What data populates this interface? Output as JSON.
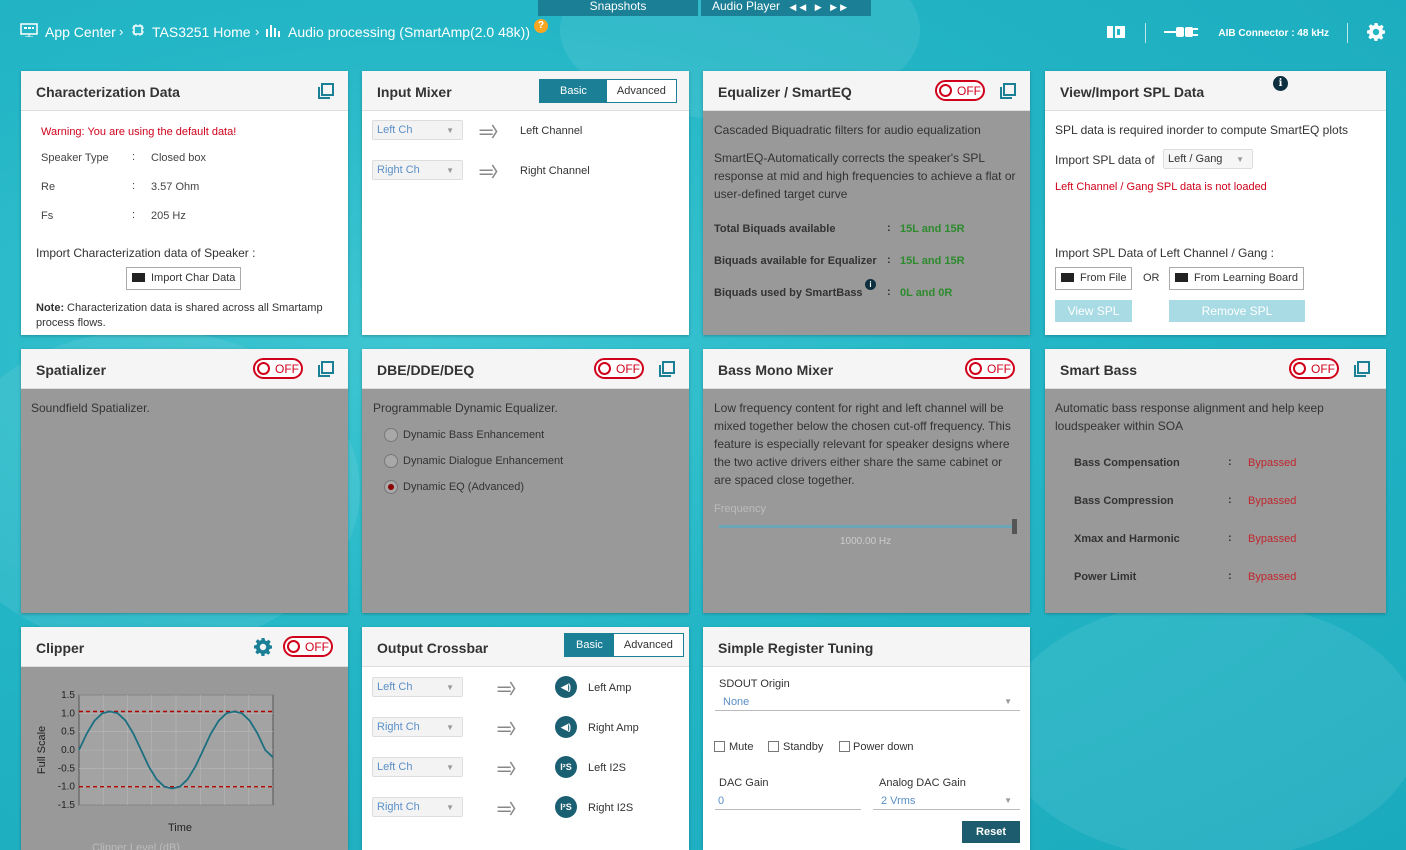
{
  "topbar": {
    "snapshots": "Snapshots",
    "audio_player": "Audio Player",
    "player_controls": "◀◀ ▶ ▶▶"
  },
  "breadcrumb": {
    "app_center": "App Center",
    "home": "TAS3251 Home",
    "audio_processing": "Audio processing (SmartAmp(2.0 48k))",
    "help": "?"
  },
  "status": {
    "connector": "AIB Connector : 48 kHz"
  },
  "colors": {
    "accent": "#1b7f96",
    "off_red": "#d0021b",
    "bypassed_red": "#c0262d",
    "value_green": "#2d8a2d"
  },
  "char": {
    "title": "Characterization Data",
    "warning": "Warning: You are using the default data!",
    "rows": [
      {
        "label": "Speaker Type",
        "sep": ":",
        "value": "Closed box"
      },
      {
        "label": "Re",
        "sep": ":",
        "value": "3.57 Ohm"
      },
      {
        "label": "Fs",
        "sep": ":",
        "value": "205 Hz"
      }
    ],
    "import_label": "Import Characterization data of Speaker :",
    "import_btn": "Import Char Data",
    "note_bold": "Note:",
    "note_line1": "Characterization data is shared across all Smartamp",
    "note_line2": "process flows."
  },
  "input_mixer": {
    "title": "Input Mixer",
    "basic": "Basic",
    "advanced": "Advanced",
    "rows": [
      {
        "select": "Left Ch",
        "target": "Left Channel"
      },
      {
        "select": "Right Ch",
        "target": "Right Channel"
      }
    ]
  },
  "equalizer": {
    "title": "Equalizer / SmartEQ",
    "toggle": "OFF",
    "desc1": "Cascaded Biquadratic filters for audio equalization",
    "desc2": [
      "SmartEQ-Automatically corrects the speaker's SPL",
      "response at mid and high frequencies to achieve a flat or",
      "user-defined target curve"
    ],
    "rows": [
      {
        "label": "Total Biquads available",
        "sep": ":",
        "value": "15L and 15R"
      },
      {
        "label": "Biquads available for Equalizer",
        "sep": ":",
        "value": "15L and 15R"
      },
      {
        "label": "Biquads used by SmartBass",
        "sep": ":",
        "value": "0L and 0R"
      }
    ],
    "info": "i"
  },
  "spl": {
    "title": "View/Import SPL Data",
    "info": "i",
    "desc": "SPL data is required inorder to compute SmartEQ plots",
    "import_of": "Import SPL data of",
    "select": "Left / Gang",
    "error": "Left Channel / Gang SPL data is not loaded",
    "import_label": "Import SPL Data of Left Channel / Gang :",
    "from_file": "From File",
    "or": "OR",
    "from_board": "From Learning Board",
    "view": "View SPL",
    "remove": "Remove SPL"
  },
  "spatializer": {
    "title": "Spatializer",
    "toggle": "OFF",
    "desc": "Soundfield Spatializer."
  },
  "dbe": {
    "title": "DBE/DDE/DEQ",
    "toggle": "OFF",
    "desc": "Programmable Dynamic Equalizer.",
    "options": [
      "Dynamic Bass Enhancement",
      "Dynamic Dialogue Enhancement",
      "Dynamic EQ (Advanced)"
    ],
    "selected": "Dynamic EQ (Advanced)"
  },
  "bassmono": {
    "title": "Bass Mono Mixer",
    "toggle": "OFF",
    "desc": [
      "Low frequency content for right and left channel will be",
      "mixed together below the chosen cut-off frequency. This",
      "feature is especially relevant for speaker designs where",
      "the two active drivers either share the same cabinet or",
      "are spaced close together."
    ],
    "slider_label": "Frequency",
    "slider_value": "1000.00 Hz",
    "slider_fraction": 1.0
  },
  "smartbass": {
    "title": "Smart Bass",
    "toggle": "OFF",
    "desc": [
      "Automatic bass response alignment and help keep",
      "loudspeaker within SOA"
    ],
    "rows": [
      {
        "label": "Bass Compensation",
        "sep": ":",
        "value": "Bypassed"
      },
      {
        "label": "Bass Compression",
        "sep": ":",
        "value": "Bypassed"
      },
      {
        "label": "Xmax and Harmonic",
        "sep": ":",
        "value": "Bypassed"
      },
      {
        "label": "Power Limit",
        "sep": ":",
        "value": "Bypassed"
      }
    ]
  },
  "clipper": {
    "title": "Clipper",
    "toggle": "OFF",
    "partial_label": "Clipper Level (dB)"
  },
  "chart_data": {
    "type": "line",
    "xlabel": "Time",
    "ylabel": "Full Scale",
    "ylim": [
      -1.5,
      1.5
    ],
    "yticks": [
      "1.5",
      "1.0",
      "0.5",
      "0.0",
      "-0.5",
      "-1.0",
      "-1.5"
    ],
    "series": [
      {
        "values": [
          0,
          0.45,
          0.8,
          1.0,
          1.05,
          1.0,
          0.8,
          0.45,
          0,
          -0.45,
          -0.8,
          -1.0,
          -1.05,
          -1.0,
          -0.8,
          -0.45,
          0,
          0.45,
          0.8,
          1.0,
          1.05,
          1.0,
          0.8,
          0.45,
          0,
          -0.2
        ]
      }
    ],
    "threshold_lines": [
      1.05,
      -1.0
    ],
    "grid": true
  },
  "crossbar": {
    "title": "Output Crossbar",
    "basic": "Basic",
    "advanced": "Advanced",
    "rows": [
      {
        "select": "Left Ch",
        "icon": "speaker-icon",
        "target": "Left Amp"
      },
      {
        "select": "Right Ch",
        "icon": "speaker-icon",
        "target": "Right Amp"
      },
      {
        "select": "Left Ch",
        "icon": "i2s-icon",
        "target": "Left I2S"
      },
      {
        "select": "Right Ch",
        "icon": "i2s-icon",
        "target": "Right I2S"
      }
    ]
  },
  "register": {
    "title": "Simple Register Tuning",
    "sdout_label": "SDOUT Origin",
    "sdout_value": "None",
    "mute": "Mute",
    "standby": "Standby",
    "powerdown": "Power down",
    "dac_label": "DAC Gain",
    "dac_value": "0",
    "analog_label": "Analog DAC Gain",
    "analog_value": "2 Vrms",
    "reset": "Reset"
  }
}
